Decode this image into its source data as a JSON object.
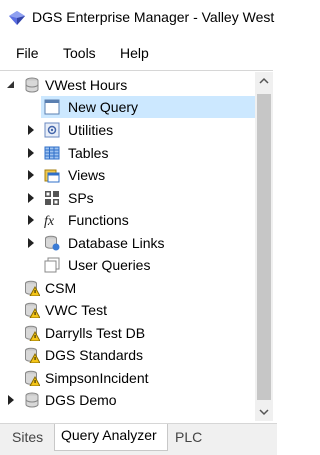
{
  "window": {
    "title": "DGS Enterprise Manager - Valley West",
    "icon": "app-diamond-icon"
  },
  "menu": {
    "items": [
      "File",
      "Tools",
      "Help"
    ]
  },
  "tree": {
    "rows": [
      {
        "label": "VWest Hours",
        "icon": "database-icon",
        "expander": "expanded"
      },
      {
        "label": "New Query",
        "icon": "query-icon",
        "selected": true
      },
      {
        "label": "Utilities",
        "icon": "utilities-icon",
        "expander": "collapsed"
      },
      {
        "label": "Tables",
        "icon": "table-icon",
        "expander": "collapsed"
      },
      {
        "label": "Views",
        "icon": "views-icon",
        "expander": "collapsed"
      },
      {
        "label": "SPs",
        "icon": "stored-procedures-icon",
        "expander": "collapsed"
      },
      {
        "label": "Functions",
        "icon": "function-icon",
        "expander": "collapsed"
      },
      {
        "label": "Database Links",
        "icon": "database-link-icon",
        "expander": "collapsed"
      },
      {
        "label": "User Queries",
        "icon": "user-queries-icon"
      },
      {
        "label": "CSM",
        "icon": "database-warning-icon"
      },
      {
        "label": "VWC Test",
        "icon": "database-warning-icon"
      },
      {
        "label": "Darrylls Test DB",
        "icon": "database-warning-icon"
      },
      {
        "label": "DGS Standards",
        "icon": "database-warning-icon"
      },
      {
        "label": "SimpsonIncident",
        "icon": "database-warning-icon"
      },
      {
        "label": "DGS Demo",
        "icon": "database-icon",
        "expander": "collapsed"
      }
    ]
  },
  "tabs": {
    "items": [
      "Sites",
      "Query Analyzer",
      "PLC"
    ],
    "active": "Query Analyzer"
  },
  "colors": {
    "selection": "#cce8ff",
    "accent": "#3a5fc8"
  }
}
